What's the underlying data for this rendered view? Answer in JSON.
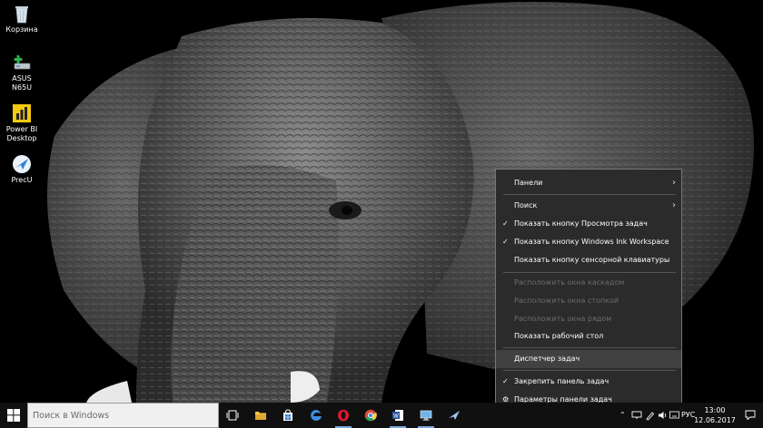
{
  "desktop": {
    "icons": [
      {
        "label": "Корзина",
        "icon": "recycle-bin-icon"
      },
      {
        "label": "ASUS N65U",
        "icon": "network-drive-icon"
      },
      {
        "label": "Power BI Desktop",
        "icon": "power-bi-icon"
      },
      {
        "label": "PrecU",
        "icon": "precu-app-icon"
      }
    ],
    "wallpaper": "elephant-photo"
  },
  "context_menu": {
    "items": [
      {
        "label": "Панели",
        "submenu": true
      },
      {
        "label": "Поиск",
        "submenu": true
      },
      {
        "label": "Показать кнопку Просмотра задач",
        "checked": true
      },
      {
        "label": "Показать кнопку Windows Ink Workspace",
        "checked": true
      },
      {
        "label": "Показать кнопку сенсорной клавиатуры"
      },
      {
        "label": "Расположить окна каскадом",
        "disabled": true
      },
      {
        "label": "Расположить окна стопкой",
        "disabled": true
      },
      {
        "label": "Расположить окна рядом",
        "disabled": true
      },
      {
        "label": "Показать рабочий стол"
      },
      {
        "label": "Диспетчер задач",
        "highlighted": true
      },
      {
        "label": "Закрепить панель задач",
        "checked": true
      },
      {
        "label": "Параметры панели задач",
        "icon": "gear-icon"
      }
    ]
  },
  "taskbar": {
    "search_placeholder": "Поиск в Windows",
    "pinned": [
      "task-view-icon",
      "file-explorer-icon",
      "store-icon",
      "edge-icon",
      "opera-icon",
      "chrome-icon",
      "word-icon",
      "remote-desktop-icon",
      "precu-app-icon"
    ],
    "tray": {
      "language": "РУС",
      "time": "13:00",
      "date": "12.06.2017"
    }
  },
  "colors": {
    "menu_bg": "#2b2b2b",
    "menu_highlight": "#414141",
    "taskbar_bg": "#101010",
    "accent": "#7aa7d7"
  }
}
